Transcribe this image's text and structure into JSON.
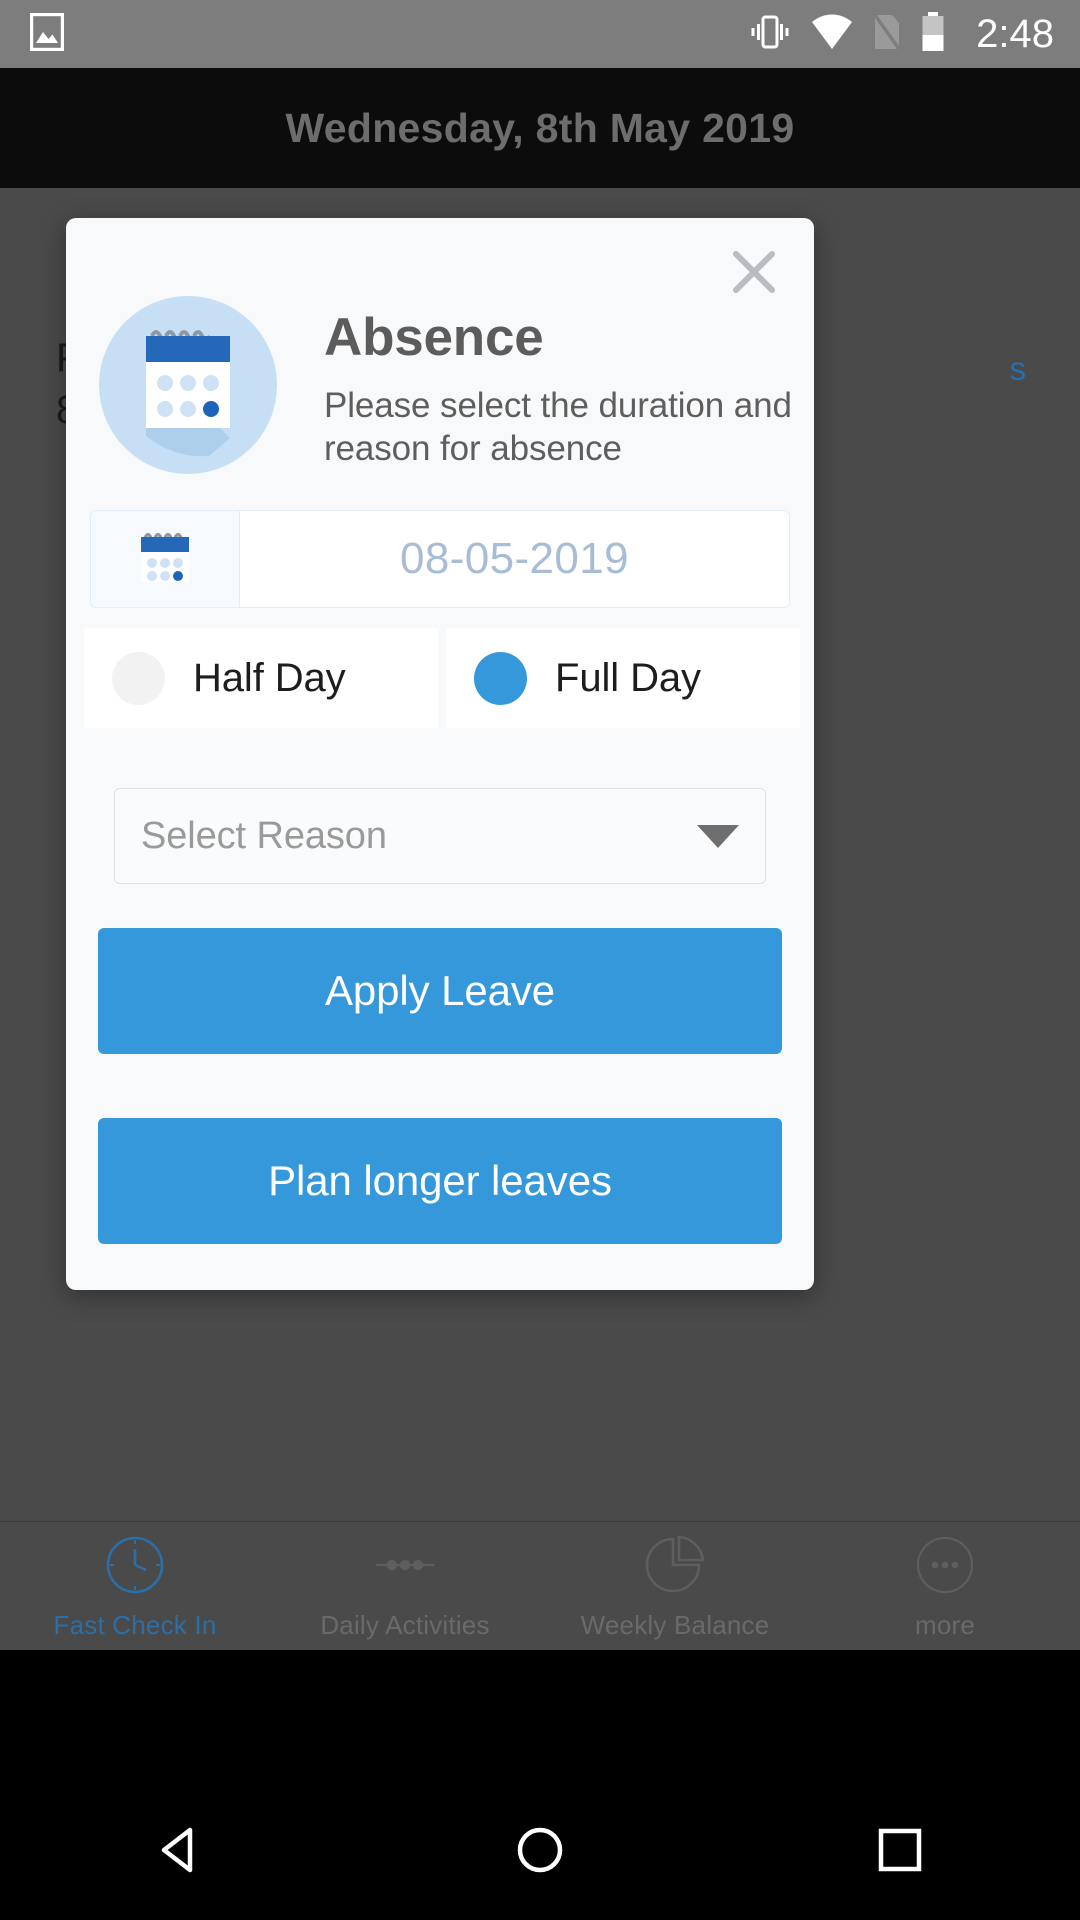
{
  "status_bar": {
    "time": "2:48",
    "icons": [
      "image-icon",
      "vibrate-icon",
      "wifi-icon",
      "sim-card-off-icon",
      "battery-icon"
    ]
  },
  "app": {
    "header_title": "Wednesday, 8th May 2019",
    "background_line1": "P",
    "background_line2": "8",
    "background_link": "s"
  },
  "dialog": {
    "close_label": "×",
    "icon": "calendar-illustration",
    "title": "Absence",
    "subtitle": "Please select the duration and reason for absence",
    "date_field": {
      "icon": "calendar-icon",
      "value": "08-05-2019"
    },
    "duration": {
      "options": [
        {
          "label": "Half Day",
          "selected": false
        },
        {
          "label": "Full Day",
          "selected": true
        }
      ]
    },
    "reason": {
      "placeholder": "Select Reason",
      "value": "Select Reason",
      "arrow": "chevron-down-icon"
    },
    "actions": {
      "apply_label": "Apply Leave",
      "plan_label": "Plan longer leaves"
    }
  },
  "tabbar": {
    "items": [
      {
        "label": "Fast Check In",
        "icon": "clock-icon",
        "active": true
      },
      {
        "label": "Daily Activities",
        "icon": "activity-dots-icon",
        "active": false
      },
      {
        "label": "Weekly Balance",
        "icon": "pie-chart-icon",
        "active": false
      },
      {
        "label": "more",
        "icon": "more-dots-icon",
        "active": false
      }
    ]
  },
  "navbar": {
    "back": "back-triangle-icon",
    "home": "home-circle-icon",
    "recents": "recents-square-icon"
  },
  "colors": {
    "accent_blue": "#3498db",
    "dialog_bg": "#f8f9fb",
    "dim_overlay": "#4a4a4a",
    "status_bar": "#7d7d7d",
    "title_gray": "#5c5c5c",
    "date_text": "#a8bdd4"
  }
}
